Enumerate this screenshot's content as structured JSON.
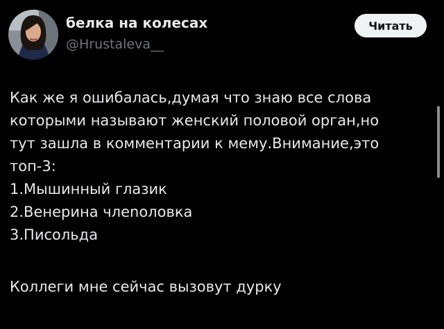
{
  "author": {
    "display_name": "белка на колесах",
    "handle": "@Hrustaleva__"
  },
  "follow_button_label": "Читать",
  "post": {
    "lines": [
      "Как же я ошибалась,думая что знаю все слова",
      "которыми называют женский половой орган,но",
      "тут зашла в комментарии к мему.Внимание,это",
      "топ-3:",
      "1.Мышинный глазик",
      "2.Венерина члеnoловка",
      "3.Писольда"
    ],
    "closing_line": "Коллеги мне сейчас вызовут дурку"
  },
  "colors": {
    "background": "#000000",
    "text": "#e7e9ea",
    "secondary_text": "#71767b",
    "button_bg": "#eff3f4"
  }
}
